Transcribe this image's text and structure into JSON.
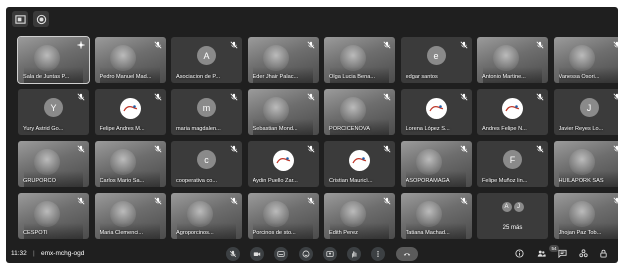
{
  "meeting": {
    "time": "11:32",
    "separator": "|",
    "code": "emx-mchg-ogd"
  },
  "participants_badge": "54",
  "tiles": [
    {
      "name": "Sala de Juntas P...",
      "kind": "video",
      "mic": "pin"
    },
    {
      "name": "Pedro Manuel Mad...",
      "kind": "video",
      "mic": "muted"
    },
    {
      "name": "Asociacion de P...",
      "kind": "avatar",
      "initial": "A",
      "mic": "muted"
    },
    {
      "name": "Eder Jhair Palac...",
      "kind": "video",
      "mic": "muted"
    },
    {
      "name": "Olga Lucia Bena...",
      "kind": "video",
      "mic": "muted"
    },
    {
      "name": "edgar santos",
      "kind": "avatar",
      "initial": "e",
      "mic": "muted"
    },
    {
      "name": "Antonio Martine...",
      "kind": "video",
      "mic": "muted"
    },
    {
      "name": "Vanessa Osori...",
      "kind": "video",
      "mic": "muted"
    },
    {
      "name": "Yury Astrid Go...",
      "kind": "avatar",
      "initial": "Y",
      "mic": "muted"
    },
    {
      "name": "Felipe Andres M...",
      "kind": "logo",
      "mic": "muted"
    },
    {
      "name": "maria magdalen...",
      "kind": "avatar",
      "initial": "m",
      "mic": "muted"
    },
    {
      "name": "Sebastian Mond...",
      "kind": "video",
      "mic": "muted"
    },
    {
      "name": "PORCICENOVA",
      "kind": "video",
      "mic": "muted"
    },
    {
      "name": "Lorena López S...",
      "kind": "logo",
      "mic": "muted"
    },
    {
      "name": "Andres Felipe N...",
      "kind": "logo",
      "mic": "muted"
    },
    {
      "name": "Javier Reyes Lo...",
      "kind": "avatar",
      "initial": "J",
      "mic": "muted"
    },
    {
      "name": "GRUPORCO",
      "kind": "video",
      "mic": "muted"
    },
    {
      "name": "Carlos Mario Sa...",
      "kind": "video",
      "mic": "muted"
    },
    {
      "name": "cooperativa co...",
      "kind": "avatar",
      "initial": "c",
      "mic": "muted"
    },
    {
      "name": "Aydin Puello Zar...",
      "kind": "logo",
      "mic": "muted"
    },
    {
      "name": "Cristian Mauricì...",
      "kind": "logo",
      "mic": "muted"
    },
    {
      "name": "ASOPORAMAGA",
      "kind": "video",
      "mic": "muted"
    },
    {
      "name": "Felipe Muñoz lin...",
      "kind": "avatar",
      "initial": "F",
      "mic": "muted"
    },
    {
      "name": "HUILAPORK SAS",
      "kind": "video",
      "mic": "muted"
    },
    {
      "name": "CESPOTI",
      "kind": "video",
      "mic": "muted"
    },
    {
      "name": "Maria Clemenci...",
      "kind": "video",
      "mic": "muted"
    },
    {
      "name": "Agroporcinos...",
      "kind": "video",
      "mic": "muted"
    },
    {
      "name": "Porcinos de sto...",
      "kind": "video",
      "mic": "muted"
    },
    {
      "name": "Edith Perez",
      "kind": "video",
      "mic": "muted"
    },
    {
      "name": "Tatiana Machad...",
      "kind": "video",
      "mic": "muted"
    },
    {
      "name": "25 más",
      "kind": "more",
      "avatars": [
        "A",
        "J"
      ],
      "mic": "none"
    },
    {
      "name": "Jhojan Paz Tob...",
      "kind": "video",
      "mic": "muted"
    }
  ],
  "icons": {
    "topbar": [
      "layout-icon",
      "record-icon"
    ],
    "controls": [
      "mic-off-icon",
      "camera-icon",
      "captions-icon",
      "emoji-icon",
      "present-icon",
      "raise-hand-icon",
      "more-options-icon",
      "end-call-icon"
    ],
    "right": [
      "info-icon",
      "people-icon",
      "chat-icon",
      "activities-icon",
      "host-controls-icon"
    ]
  },
  "colors": {
    "background": "#1f1f1f",
    "tile": "#3b3b3b",
    "control": "#3c4043",
    "text": "#ffffff"
  }
}
